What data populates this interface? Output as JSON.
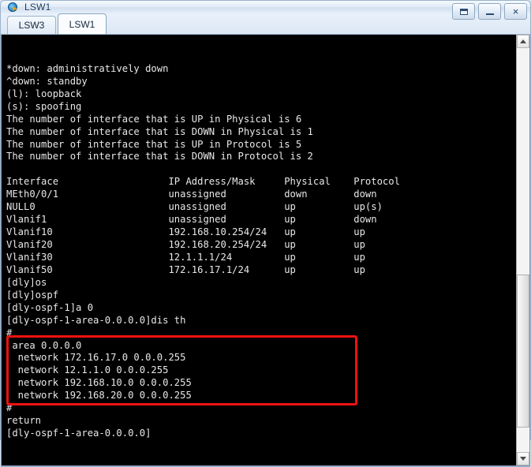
{
  "window": {
    "title": "LSW1",
    "app_icon": "router-globe-icon",
    "buttons": {
      "restore": "restore-button",
      "minimize": "minimize-button",
      "close": "×"
    }
  },
  "tabs": [
    {
      "label": "LSW3",
      "active": false
    },
    {
      "label": "LSW1",
      "active": true
    }
  ],
  "terminal": {
    "lines": [
      "*down: administratively down",
      "^down: standby",
      "(l): loopback",
      "(s): spoofing",
      "The number of interface that is UP in Physical is 6",
      "The number of interface that is DOWN in Physical is 1",
      "The number of interface that is UP in Protocol is 5",
      "The number of interface that is DOWN in Protocol is 2",
      "",
      "Interface                   IP Address/Mask     Physical    Protocol",
      "MEth0/0/1                   unassigned          down        down",
      "NULL0                       unassigned          up          up(s)",
      "Vlanif1                     unassigned          up          down",
      "Vlanif10                    192.168.10.254/24   up          up",
      "Vlanif20                    192.168.20.254/24   up          up",
      "Vlanif30                    12.1.1.1/24         up          up",
      "Vlanif50                    172.16.17.1/24      up          up",
      "[dly]os",
      "[dly]ospf",
      "[dly-ospf-1]a 0",
      "[dly-ospf-1-area-0.0.0.0]dis th",
      "#",
      " area 0.0.0.0",
      "  network 172.16.17.0 0.0.0.255",
      "  network 12.1.1.0 0.0.0.255",
      "  network 192.168.10.0 0.0.0.255",
      "  network 192.168.20.0 0.0.0.255",
      "#",
      "return",
      "[dly-ospf-1-area-0.0.0.0]"
    ],
    "highlight_color": "#ee1111"
  },
  "scrollbar": {
    "up_arrow": "scroll-up-arrow",
    "down_arrow": "scroll-down-arrow"
  },
  "statusbar": {
    "cursor_glyph": "▲"
  }
}
